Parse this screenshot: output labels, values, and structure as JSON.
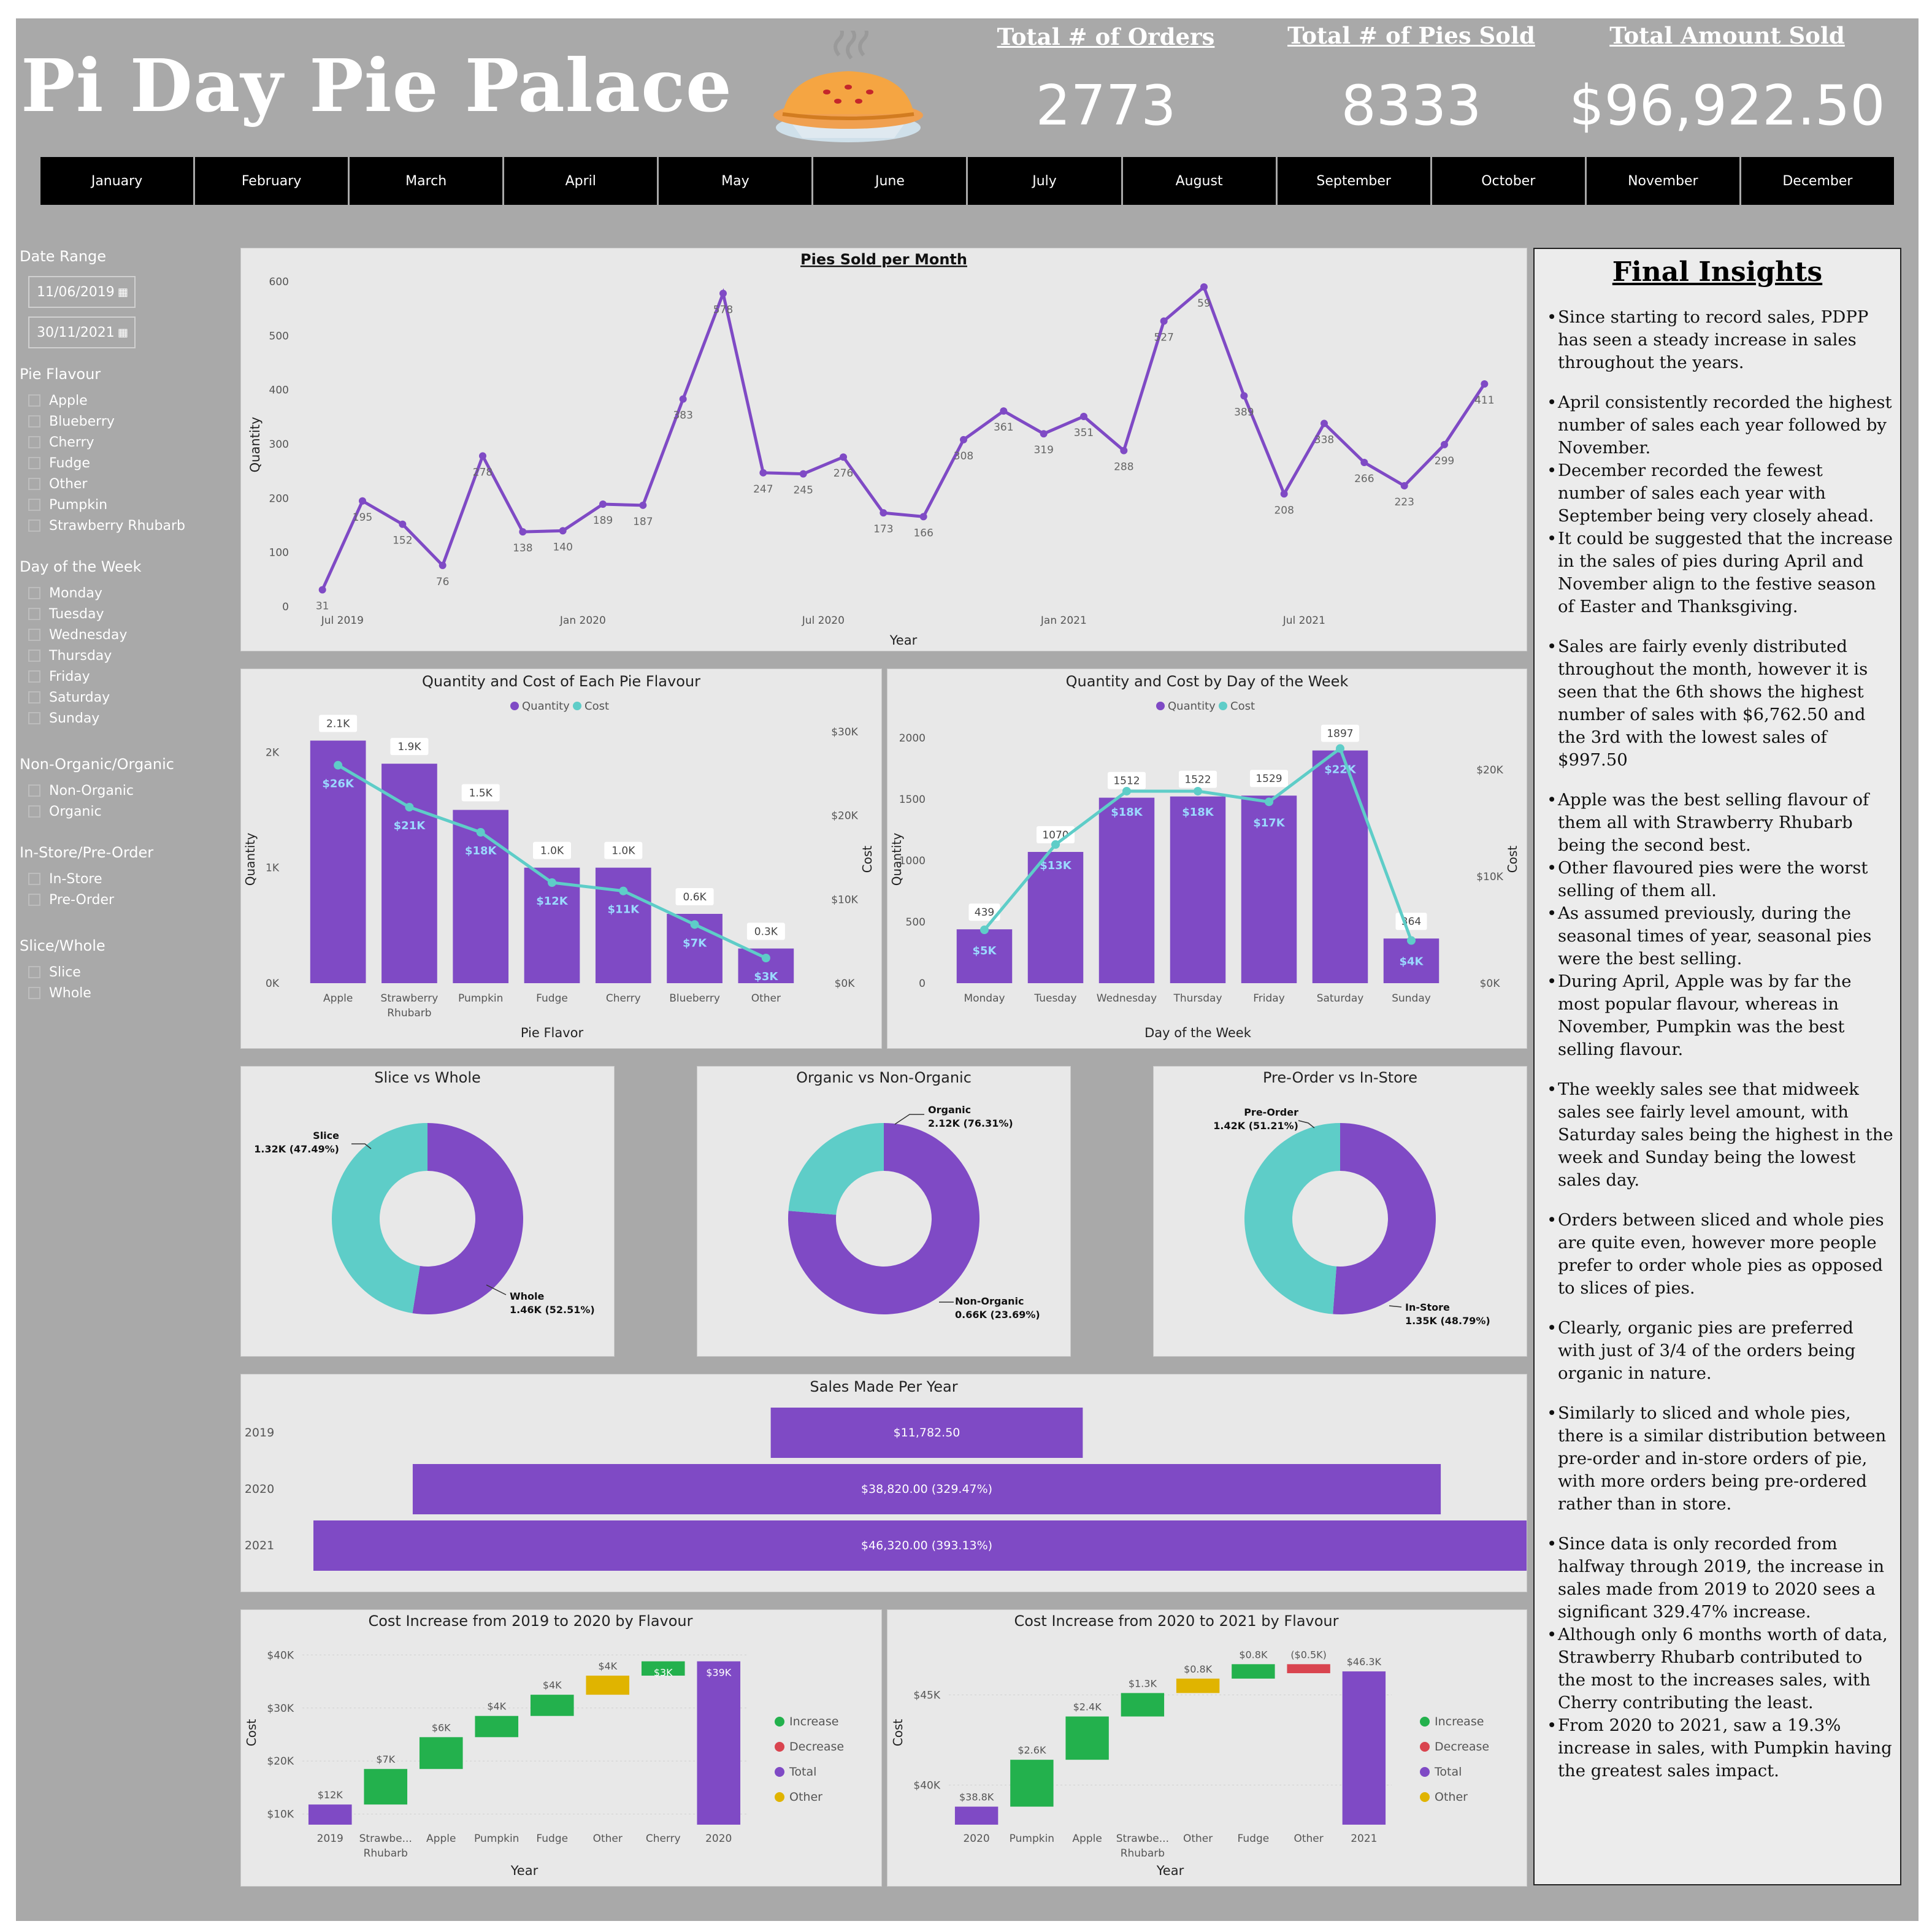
{
  "header": {
    "title": "Pi Day Pie Palace",
    "kpis": [
      {
        "label": "Total # of Orders",
        "value": "2773"
      },
      {
        "label": "Total # of Pies Sold",
        "value": "8333"
      },
      {
        "label": "Total Amount Sold",
        "value": "$96,922.50"
      }
    ],
    "pie_icon": "pie-icon"
  },
  "months": [
    "January",
    "February",
    "March",
    "April",
    "May",
    "June",
    "July",
    "August",
    "September",
    "October",
    "November",
    "December"
  ],
  "slicers": {
    "date_range": {
      "label": "Date Range",
      "start": "11/06/2019",
      "end": "30/11/2021"
    },
    "pie_flavour": {
      "label": "Pie Flavour",
      "options": [
        "Apple",
        "Blueberry",
        "Cherry",
        "Fudge",
        "Other",
        "Pumpkin",
        "Strawberry Rhubarb"
      ]
    },
    "day_of_week": {
      "label": "Day of the Week",
      "options": [
        "Monday",
        "Tuesday",
        "Wednesday",
        "Thursday",
        "Friday",
        "Saturday",
        "Sunday"
      ]
    },
    "organic": {
      "label": "Non-Organic/Organic",
      "options": [
        "Non-Organic",
        "Organic"
      ]
    },
    "store": {
      "label": "In-Store/Pre-Order",
      "options": [
        "In-Store",
        "Pre-Order"
      ]
    },
    "slice": {
      "label": "Slice/Whole",
      "options": [
        "Slice",
        "Whole"
      ]
    }
  },
  "colors": {
    "purple": "#7f4ac5",
    "teal": "#5ecdc8",
    "increase": "#23b14d",
    "decrease": "#d9444f",
    "total": "#7f4ac5",
    "other": "#e0b400"
  },
  "chart_data": [
    {
      "type": "line",
      "title": "Pies Sold per Month",
      "xlabel": "Year",
      "ylabel": "Quantity",
      "ylim": [
        0,
        600
      ],
      "yticks": [
        0,
        100,
        200,
        300,
        400,
        500,
        600
      ],
      "xticks": [
        {
          "at": 0.5,
          "label": "Jul 2019"
        },
        {
          "at": 6.5,
          "label": "Jan 2020"
        },
        {
          "at": 12.5,
          "label": "Jul 2020"
        },
        {
          "at": 18.5,
          "label": "Jan 2021"
        },
        {
          "at": 24.5,
          "label": "Jul 2021"
        }
      ],
      "values": [
        31,
        195,
        152,
        76,
        278,
        138,
        140,
        189,
        187,
        383,
        578,
        247,
        245,
        276,
        173,
        166,
        308,
        361,
        319,
        351,
        288,
        527,
        590,
        389,
        208,
        338,
        266,
        223,
        299,
        411
      ],
      "labels": [
        "31",
        "195",
        "152",
        "76",
        "278",
        "138",
        "140",
        "189",
        "187",
        "383",
        "578",
        "247",
        "245",
        "276",
        "173",
        "166",
        "308",
        "361",
        "319",
        "351",
        "288",
        "527",
        "59",
        "389",
        "208",
        "338",
        "266",
        "223",
        "299",
        "411"
      ]
    },
    {
      "type": "bar",
      "title": "Quantity and Cost of Each Pie Flavour",
      "legend": [
        "Quantity",
        "Cost"
      ],
      "xlabel": "Pie Flavor",
      "ylabel": "Quantity",
      "y2label": "Cost",
      "categories": [
        "Apple",
        "Strawberry Rhubarb",
        "Pumpkin",
        "Fudge",
        "Cherry",
        "Blueberry",
        "Other"
      ],
      "series": [
        {
          "name": "Quantity",
          "values": [
            2100,
            1900,
            1500,
            1000,
            1000,
            600,
            300
          ],
          "labels": [
            "2.1K",
            "1.9K",
            "1.5K",
            "1.0K",
            "1.0K",
            "0.6K",
            "0.3K"
          ]
        },
        {
          "name": "Cost",
          "values": [
            26000,
            21000,
            18000,
            12000,
            11000,
            7000,
            3000
          ],
          "labels": [
            "$26K",
            "$21K",
            "$18K",
            "$12K",
            "$11K",
            "$7K",
            "$3K"
          ]
        }
      ],
      "ylim": [
        0,
        2400
      ],
      "yticks": [
        {
          "v": 0,
          "l": "0K"
        },
        {
          "v": 1000,
          "l": "1K"
        },
        {
          "v": 2000,
          "l": "2K"
        }
      ],
      "y2lim": [
        0,
        30000
      ],
      "y2ticks": [
        {
          "v": 0,
          "l": "$0K"
        },
        {
          "v": 10000,
          "l": "$10K"
        },
        {
          "v": 20000,
          "l": "$20K"
        },
        {
          "v": 30000,
          "l": "$30K"
        }
      ]
    },
    {
      "type": "bar",
      "title": "Quantity and Cost by Day of the Week",
      "legend": [
        "Quantity",
        "Cost"
      ],
      "xlabel": "Day of the Week",
      "ylabel": "Quantity",
      "y2label": "Cost",
      "categories": [
        "Monday",
        "Tuesday",
        "Wednesday",
        "Thursday",
        "Friday",
        "Saturday",
        "Sunday"
      ],
      "series": [
        {
          "name": "Quantity",
          "values": [
            439,
            1070,
            1512,
            1522,
            1529,
            1897,
            364
          ],
          "labels": [
            "439",
            "1070",
            "1512",
            "1522",
            "1529",
            "1897",
            "364"
          ]
        },
        {
          "name": "Cost",
          "values": [
            5000,
            13000,
            18000,
            18000,
            17000,
            22000,
            4000
          ],
          "labels": [
            "$5K",
            "$13K",
            "$18K",
            "$18K",
            "$17K",
            "$22K",
            "$4K"
          ]
        }
      ],
      "ylim": [
        0,
        2000
      ],
      "yticks": [
        {
          "v": 0,
          "l": "0"
        },
        {
          "v": 500,
          "l": "500"
        },
        {
          "v": 1000,
          "l": "1000"
        },
        {
          "v": 1500,
          "l": "1500"
        },
        {
          "v": 2000,
          "l": "2000"
        }
      ],
      "y2lim": [
        0,
        23000
      ],
      "y2ticks": [
        {
          "v": 0,
          "l": "$0K"
        },
        {
          "v": 10000,
          "l": "$10K"
        },
        {
          "v": 20000,
          "l": "$20K"
        }
      ]
    },
    {
      "type": "pie",
      "title": "Slice vs Whole",
      "slices": [
        {
          "name": "Whole",
          "value": 52.51,
          "label": "1.46K (52.51%)"
        },
        {
          "name": "Slice",
          "value": 47.49,
          "label": "1.32K (47.49%)"
        }
      ]
    },
    {
      "type": "pie",
      "title": "Organic vs Non-Organic",
      "slices": [
        {
          "name": "Organic",
          "value": 76.31,
          "label": "2.12K (76.31%)"
        },
        {
          "name": "Non-Organic",
          "value": 23.69,
          "label": "0.66K (23.69%)"
        }
      ]
    },
    {
      "type": "pie",
      "title": "Pre-Order vs In-Store",
      "slices": [
        {
          "name": "Pre-Order",
          "value": 51.21,
          "label": "1.42K (51.21%)"
        },
        {
          "name": "In-Store",
          "value": 48.79,
          "label": "1.35K (48.79%)"
        }
      ]
    },
    {
      "type": "bar",
      "title": "Sales Made Per Year",
      "categories": [
        "2019",
        "2020",
        "2021"
      ],
      "values": [
        11782.5,
        38820.0,
        46320.0
      ],
      "labels": [
        "$11,782.50",
        "$38,820.00 (329.47%)",
        "$46,320.00 (393.13%)"
      ]
    },
    {
      "type": "bar",
      "subtype": "waterfall",
      "title": "Cost Increase from 2019 to 2020 by Flavour",
      "xlabel": "Year",
      "ylabel": "Cost",
      "legend": [
        "Increase",
        "Decrease",
        "Total",
        "Other"
      ],
      "categories": [
        "2019",
        "Strawberry Rhubarb",
        "Apple",
        "Pumpkin",
        "Fudge",
        "Other",
        "Cherry",
        "2020"
      ],
      "ticklabels": [
        "2019",
        "Strawbe... Rhubarb",
        "Apple",
        "Pumpkin",
        "Fudge",
        "Other",
        "Cherry",
        "2020"
      ],
      "steps": [
        {
          "kind": "total",
          "value": 11800,
          "label": "$12K"
        },
        {
          "kind": "increase",
          "value": 6700,
          "label": "$7K"
        },
        {
          "kind": "increase",
          "value": 6000,
          "label": "$6K"
        },
        {
          "kind": "increase",
          "value": 4000,
          "label": "$4K"
        },
        {
          "kind": "increase",
          "value": 4000,
          "label": "$4K"
        },
        {
          "kind": "other",
          "value": 3600,
          "label": "$4K"
        },
        {
          "kind": "increase",
          "value": 2700,
          "label": "$3K"
        },
        {
          "kind": "total",
          "value": 38800,
          "label": "$39K"
        }
      ],
      "ylim": [
        8000,
        42000
      ],
      "yticks": [
        {
          "v": 10000,
          "l": "$10K"
        },
        {
          "v": 20000,
          "l": "$20K"
        },
        {
          "v": 30000,
          "l": "$30K"
        },
        {
          "v": 40000,
          "l": "$40K"
        }
      ]
    },
    {
      "type": "bar",
      "subtype": "waterfall",
      "title": "Cost Increase from 2020 to 2021 by Flavour",
      "xlabel": "Year",
      "ylabel": "Cost",
      "legend": [
        "Increase",
        "Decrease",
        "Total",
        "Other"
      ],
      "categories": [
        "2020",
        "Pumpkin",
        "Apple",
        "Strawberry Rhubarb",
        "Other",
        "Fudge",
        "Other",
        "2021"
      ],
      "ticklabels": [
        "2020",
        "Pumpkin",
        "Apple",
        "Strawbe... Rhubarb",
        "Other",
        "Fudge",
        "Other",
        "2021"
      ],
      "steps": [
        {
          "kind": "total",
          "value": 38800,
          "label": "$38.8K"
        },
        {
          "kind": "increase",
          "value": 2600,
          "label": "$2.6K"
        },
        {
          "kind": "increase",
          "value": 2400,
          "label": "$2.4K"
        },
        {
          "kind": "increase",
          "value": 1300,
          "label": "$1.3K"
        },
        {
          "kind": "other",
          "value": 800,
          "label": "$0.8K"
        },
        {
          "kind": "increase",
          "value": 800,
          "label": "$0.8K"
        },
        {
          "kind": "decrease",
          "value": -500,
          "label": "($0.5K)"
        },
        {
          "kind": "total",
          "value": 46300,
          "label": "$46.3K"
        }
      ],
      "ylim": [
        37800,
        47800
      ],
      "yticks": [
        {
          "v": 40000,
          "l": "$40K"
        },
        {
          "v": 45000,
          "l": "$45K"
        }
      ]
    }
  ],
  "insights": {
    "title": "Final Insights",
    "items": [
      {
        "gap": false,
        "text": "Since starting to record sales, PDPP has seen a steady increase in sales throughout the years."
      },
      {
        "gap": true,
        "text": "April consistently recorded the highest number of sales each year followed by November."
      },
      {
        "gap": false,
        "text": "December recorded the fewest number of sales each year with September being very closely ahead."
      },
      {
        "gap": false,
        "text": "It could be suggested that the increase in the sales of pies during April and November align to the festive season of Easter and Thanksgiving."
      },
      {
        "gap": true,
        "text": "Sales are fairly evenly distributed throughout the month, however it is seen that the 6th shows the highest number of sales with $6,762.50 and the 3rd with the lowest sales of $997.50"
      },
      {
        "gap": true,
        "text": "Apple was the best selling flavour of them all with Strawberry Rhubarb being the second best."
      },
      {
        "gap": false,
        "text": "Other flavoured pies were the worst selling of them all."
      },
      {
        "gap": false,
        "text": "As assumed previously, during the seasonal times of year, seasonal pies were the best selling."
      },
      {
        "gap": false,
        "text": "During April, Apple was by far the most popular flavour, whereas in November, Pumpkin was the best selling flavour."
      },
      {
        "gap": true,
        "text": "The weekly sales see that midweek sales see fairly level amount, with Saturday sales being the highest in the week and Sunday being the lowest sales day."
      },
      {
        "gap": true,
        "text": "Orders between sliced and whole pies are quite even, however more people prefer to order whole pies as opposed to slices of pies."
      },
      {
        "gap": true,
        "text": "Clearly, organic pies are preferred with just of 3/4 of the orders being organic in nature."
      },
      {
        "gap": true,
        "text": "Similarly to sliced and whole pies, there is a similar distribution between pre-order and in-store orders of pie, with more orders being pre-ordered rather than in store."
      },
      {
        "gap": true,
        "text": "Since data is only recorded from halfway through 2019, the increase in sales made from 2019 to 2020 sees a significant 329.47% increase."
      },
      {
        "gap": false,
        "text": "Although only 6 months worth of data, Strawberry Rhubarb contributed to the most to the increases sales, with Cherry contributing the least."
      },
      {
        "gap": false,
        "text": "From 2020 to 2021, saw a 19.3% increase in sales, with Pumpkin having the greatest sales impact."
      }
    ]
  }
}
